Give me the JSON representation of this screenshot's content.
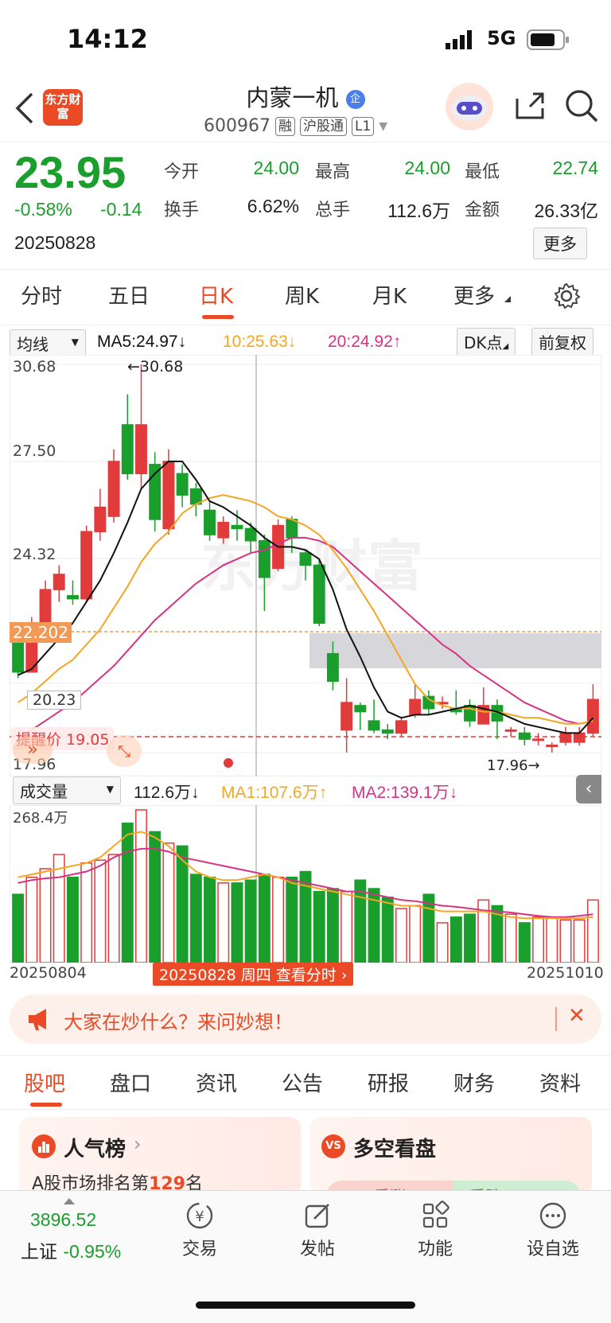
{
  "status": {
    "time": "14:12",
    "network": "5G"
  },
  "header": {
    "logo_text": "东方财富",
    "stock_name": "内蒙一机",
    "stock_badge": "企",
    "code": "600967",
    "tags": [
      "融",
      "沪股通",
      "L1"
    ]
  },
  "quote": {
    "price": "23.95",
    "change_pct": "-0.58%",
    "change": "-0.14",
    "date": "20250828",
    "fields": [
      {
        "label": "今开",
        "value": "24.00",
        "color": "#1a9e2c"
      },
      {
        "label": "最高",
        "value": "24.00",
        "color": "#1a9e2c"
      },
      {
        "label": "最低",
        "value": "22.74",
        "color": "#1a9e2c"
      },
      {
        "label": "换手",
        "value": "6.62%",
        "color": "#222222"
      },
      {
        "label": "总手",
        "value": "112.6万",
        "color": "#222222"
      },
      {
        "label": "金额",
        "value": "26.33亿",
        "color": "#222222"
      }
    ],
    "more_label": "更多"
  },
  "chart_tabs": {
    "items": [
      "分时",
      "五日",
      "日K",
      "周K",
      "月K",
      "更多"
    ],
    "active": "日K"
  },
  "ma_legend": {
    "selector": "均线",
    "ma5": "MA5:24.97",
    "ma10": "10:25.63",
    "ma20": "20:24.92",
    "dk_button": "DK点",
    "adjust_button": "前复权"
  },
  "price_axis": {
    "ticks": [
      "30.68",
      "27.50",
      "24.32",
      "20.23",
      "17.96"
    ]
  },
  "annotations": {
    "high_label": "←30.68",
    "low_label": "17.96→",
    "crosshair_price": "22.202",
    "alert_label": "提醒价 19.05"
  },
  "volume_legend": {
    "selector": "成交量",
    "vol": "112.6万",
    "ma1": "MA1:107.6万",
    "ma2": "MA2:139.1万",
    "max_label": "268.4万"
  },
  "date_axis": {
    "start": "20250804",
    "end": "20251010",
    "crosshair_label": "20250828 周四 查看分时"
  },
  "colors": {
    "up": "#e23b3b",
    "down": "#1a9e2c",
    "ma5": "#111111",
    "ma10": "#f5a623",
    "ma20": "#d63384",
    "accent": "#ea4a25"
  },
  "chart_data": {
    "type": "candlestick",
    "ylim": [
      17.96,
      30.68
    ],
    "candles": [
      {
        "o": 21.9,
        "c": 20.6,
        "h": 22.2,
        "l": 20.4
      },
      {
        "o": 20.6,
        "c": 22.0,
        "h": 22.4,
        "l": 20.6
      },
      {
        "o": 22.0,
        "c": 23.3,
        "h": 23.6,
        "l": 21.8
      },
      {
        "o": 23.3,
        "c": 23.8,
        "h": 24.1,
        "l": 22.9
      },
      {
        "o": 23.1,
        "c": 23.0,
        "h": 23.6,
        "l": 22.8
      },
      {
        "o": 23.0,
        "c": 25.2,
        "h": 25.4,
        "l": 22.9
      },
      {
        "o": 25.2,
        "c": 26.0,
        "h": 26.6,
        "l": 24.9
      },
      {
        "o": 25.7,
        "c": 27.5,
        "h": 27.9,
        "l": 25.5
      },
      {
        "o": 28.7,
        "c": 27.1,
        "h": 29.7,
        "l": 26.9
      },
      {
        "o": 27.1,
        "c": 28.7,
        "h": 30.68,
        "l": 26.6
      },
      {
        "o": 27.4,
        "c": 25.6,
        "h": 27.8,
        "l": 25.2
      },
      {
        "o": 25.3,
        "c": 27.5,
        "h": 27.9,
        "l": 25.1
      },
      {
        "o": 27.1,
        "c": 26.4,
        "h": 27.4,
        "l": 26.0
      },
      {
        "o": 26.6,
        "c": 26.1,
        "h": 26.8,
        "l": 25.7
      },
      {
        "o": 25.9,
        "c": 25.1,
        "h": 26.2,
        "l": 24.9
      },
      {
        "o": 25.0,
        "c": 25.5,
        "h": 25.7,
        "l": 24.8
      },
      {
        "o": 25.4,
        "c": 25.3,
        "h": 25.9,
        "l": 24.9
      },
      {
        "o": 25.3,
        "c": 24.9,
        "h": 25.5,
        "l": 24.5
      },
      {
        "o": 24.9,
        "c": 23.7,
        "h": 25.1,
        "l": 22.6
      },
      {
        "o": 24.0,
        "c": 25.4,
        "h": 25.6,
        "l": 23.9
      },
      {
        "o": 25.6,
        "c": 25.0,
        "h": 25.7,
        "l": 24.5
      },
      {
        "o": 24.5,
        "c": 24.1,
        "h": 24.6,
        "l": 23.6
      },
      {
        "o": 24.1,
        "c": 22.2,
        "h": 24.3,
        "l": 22.1
      },
      {
        "o": 21.2,
        "c": 20.3,
        "h": 21.6,
        "l": 20.0
      },
      {
        "o": 18.7,
        "c": 19.6,
        "h": 20.4,
        "l": 17.96
      },
      {
        "o": 19.5,
        "c": 19.3,
        "h": 19.6,
        "l": 18.7
      },
      {
        "o": 19.0,
        "c": 18.7,
        "h": 19.7,
        "l": 18.6
      },
      {
        "o": 18.7,
        "c": 18.6,
        "h": 18.9,
        "l": 18.4
      },
      {
        "o": 18.6,
        "c": 19.0,
        "h": 19.1,
        "l": 18.5
      },
      {
        "o": 19.2,
        "c": 19.7,
        "h": 20.2,
        "l": 19.1
      },
      {
        "o": 19.8,
        "c": 19.4,
        "h": 20.0,
        "l": 19.2
      },
      {
        "o": 19.6,
        "c": 19.6,
        "h": 19.8,
        "l": 19.4
      },
      {
        "o": 19.4,
        "c": 19.3,
        "h": 20.0,
        "l": 19.2
      },
      {
        "o": 19.5,
        "c": 19.0,
        "h": 19.7,
        "l": 18.8
      },
      {
        "o": 18.9,
        "c": 19.5,
        "h": 20.1,
        "l": 18.9
      },
      {
        "o": 19.5,
        "c": 19.0,
        "h": 19.7,
        "l": 18.4
      },
      {
        "o": 18.7,
        "c": 18.7,
        "h": 18.8,
        "l": 18.5
      },
      {
        "o": 18.6,
        "c": 18.4,
        "h": 18.8,
        "l": 18.2
      },
      {
        "o": 18.4,
        "c": 18.4,
        "h": 18.6,
        "l": 18.2
      },
      {
        "o": 18.2,
        "c": 18.2,
        "h": 18.3,
        "l": 17.96
      },
      {
        "o": 18.3,
        "c": 18.6,
        "h": 18.8,
        "l": 18.2
      },
      {
        "o": 18.3,
        "c": 18.6,
        "h": 18.8,
        "l": 18.2
      },
      {
        "o": 18.6,
        "c": 19.7,
        "h": 20.2,
        "l": 18.5
      }
    ],
    "ma5": [
      20.5,
      20.7,
      21.2,
      21.7,
      22.2,
      22.9,
      23.6,
      24.5,
      25.5,
      26.6,
      27.1,
      27.5,
      27.5,
      26.9,
      26.2,
      26.0,
      25.7,
      25.4,
      25.0,
      24.7,
      24.7,
      24.6,
      24.3,
      23.3,
      22.0,
      21.1,
      20.1,
      19.3,
      19.1,
      19.2,
      19.2,
      19.3,
      19.4,
      19.5,
      19.4,
      19.3,
      19.1,
      18.9,
      18.8,
      18.7,
      18.6,
      18.6,
      19.1
    ],
    "ma10": [
      19.6,
      19.9,
      20.3,
      20.7,
      21.0,
      21.5,
      22.0,
      22.7,
      23.4,
      24.2,
      24.8,
      25.2,
      25.8,
      26.1,
      26.3,
      26.4,
      26.3,
      26.2,
      26.0,
      25.7,
      25.6,
      25.4,
      25.1,
      24.6,
      24.0,
      23.3,
      22.6,
      21.8,
      21.0,
      20.2,
      19.7,
      19.5,
      19.4,
      19.4,
      19.3,
      19.3,
      19.2,
      19.1,
      19.1,
      19.0,
      18.9,
      18.9,
      19.0
    ],
    "ma20": [
      18.4,
      18.7,
      19.0,
      19.3,
      19.6,
      20.0,
      20.4,
      20.8,
      21.3,
      21.8,
      22.3,
      22.7,
      23.1,
      23.5,
      23.8,
      24.1,
      24.3,
      24.5,
      24.6,
      24.8,
      25.0,
      25.0,
      24.9,
      24.7,
      24.3,
      23.9,
      23.5,
      23.1,
      22.7,
      22.3,
      21.9,
      21.5,
      21.2,
      20.8,
      20.5,
      20.2,
      19.9,
      19.6,
      19.4,
      19.2,
      19.0,
      18.9,
      19.0
    ],
    "volume": [
      120,
      150,
      165,
      190,
      150,
      175,
      180,
      190,
      245,
      268.4,
      230,
      210,
      205,
      155,
      150,
      140,
      140,
      145,
      155,
      150,
      150,
      160,
      125,
      130,
      125,
      145,
      130,
      115,
      95,
      100,
      120,
      70,
      80,
      85,
      110,
      100,
      85,
      70,
      80,
      80,
      75,
      75,
      110
    ],
    "vol_ma1": [
      150,
      155,
      160,
      165,
      170,
      175,
      185,
      205,
      225,
      230,
      220,
      205,
      180,
      160,
      150,
      145,
      145,
      150,
      155,
      150,
      140,
      135,
      130,
      125,
      120,
      115,
      110,
      105,
      100,
      100,
      95,
      90,
      90,
      90,
      90,
      85,
      80,
      78,
      78,
      78,
      78,
      78,
      80
    ],
    "vol_ma2": [
      140,
      145,
      148,
      150,
      155,
      160,
      170,
      185,
      195,
      200,
      200,
      195,
      185,
      180,
      175,
      170,
      165,
      160,
      155,
      150,
      145,
      140,
      135,
      130,
      125,
      125,
      120,
      115,
      110,
      108,
      104,
      100,
      98,
      95,
      92,
      90,
      88,
      85,
      82,
      80,
      80,
      82,
      85
    ]
  },
  "info_banner": {
    "text": "大家在炒什么？来问妙想！"
  },
  "bottom_tabs": {
    "items": [
      "股吧",
      "盘口",
      "资讯",
      "公告",
      "研报",
      "财务",
      "资料"
    ],
    "active": "股吧"
  },
  "cards": [
    {
      "title": "人气榜",
      "subtitle": "A股市场排名第",
      "rank": "129",
      "suffix": "名"
    },
    {
      "title": "多空看盘",
      "bull": "看涨",
      "bear": "看跌"
    }
  ],
  "footer": {
    "index_value": "3896.52",
    "index_name": "上证",
    "index_change": "-0.95%",
    "nav": [
      {
        "label": "交易",
        "icon": "trade-icon"
      },
      {
        "label": "发帖",
        "icon": "post-icon"
      },
      {
        "label": "功能",
        "icon": "apps-icon"
      },
      {
        "label": "设自选",
        "icon": "more-icon"
      }
    ]
  }
}
